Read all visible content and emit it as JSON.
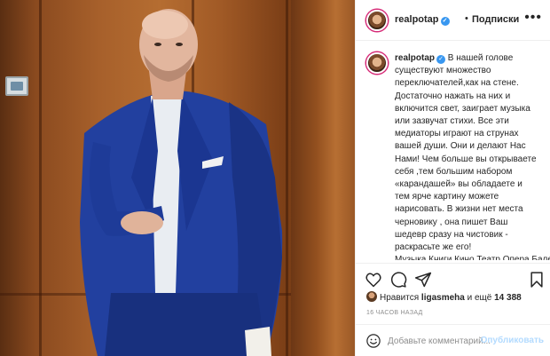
{
  "post": {
    "username": "realpotap",
    "follow_status": "Подписки",
    "separator": "•",
    "more_icon": "more-horizontal-icon",
    "caption": "В нашей голове существуют множество переключателей,как на стене. Достаточно нажать на них и включится свет, заиграет музыка или зазвучат стихи. Все эти медиаторы играют на струнах вашей души. Они и делают Нас Нами! Чем больше вы открываете себя ,тем большим набором «карандашей» вы обладаете и тем ярче картину можете нарисовать. В жизни нет места черновику , она пишет Ваш шедевр сразу на чистовик - раскрасьте же его! Музыка,Книги,Кино,Театр,Опера,Балет,Музеи и Фотогалереи,Музыка! Наполняйте себя искусством и творчеством,раскрывайте свою душу навстречу прекрасному и ..."
  },
  "actions": {
    "like_icon": "heart-icon",
    "comment_icon": "comment-bubble-icon",
    "share_icon": "paper-plane-icon",
    "save_icon": "bookmark-icon"
  },
  "likes": {
    "prefix": "Нравится",
    "user": "ligasmeha",
    "suffix": "и ещё",
    "count": "14 388"
  },
  "timestamp": "16 ЧАСОВ НАЗАД",
  "comment_box": {
    "placeholder": "Добавьте комментарий...",
    "publish_label": "Опубликовать",
    "emoji_icon": "emoji-smile-icon"
  },
  "colors": {
    "verified_badge": "#3897f0",
    "publish_disabled": "#b3dbff",
    "suit_blue": "#1f3f9c"
  }
}
